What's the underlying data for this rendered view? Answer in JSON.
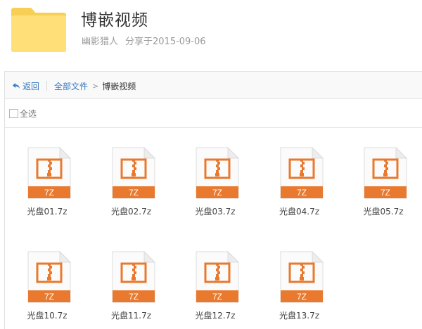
{
  "share": {
    "title": "博嵌视频",
    "owner": "幽影猎人",
    "share_date_text": "分享于2015-09-06"
  },
  "toolbar": {
    "back_label": "返回",
    "root_label": "全部文件",
    "chevron": ">",
    "current_folder": "博嵌视频"
  },
  "select_all_label": "全选",
  "file_type_label": "7Z",
  "files": [
    {
      "name": "光盘01.7z"
    },
    {
      "name": "光盘02.7z"
    },
    {
      "name": "光盘03.7z"
    },
    {
      "name": "光盘04.7z"
    },
    {
      "name": "光盘05.7z"
    },
    {
      "name": "光盘10.7z"
    },
    {
      "name": "光盘11.7z"
    },
    {
      "name": "光盘12.7z"
    },
    {
      "name": "光盘13.7z"
    }
  ],
  "colors": {
    "folder": "#ffd95c",
    "archive_accent": "#e8792e",
    "link": "#3b7bbf"
  }
}
